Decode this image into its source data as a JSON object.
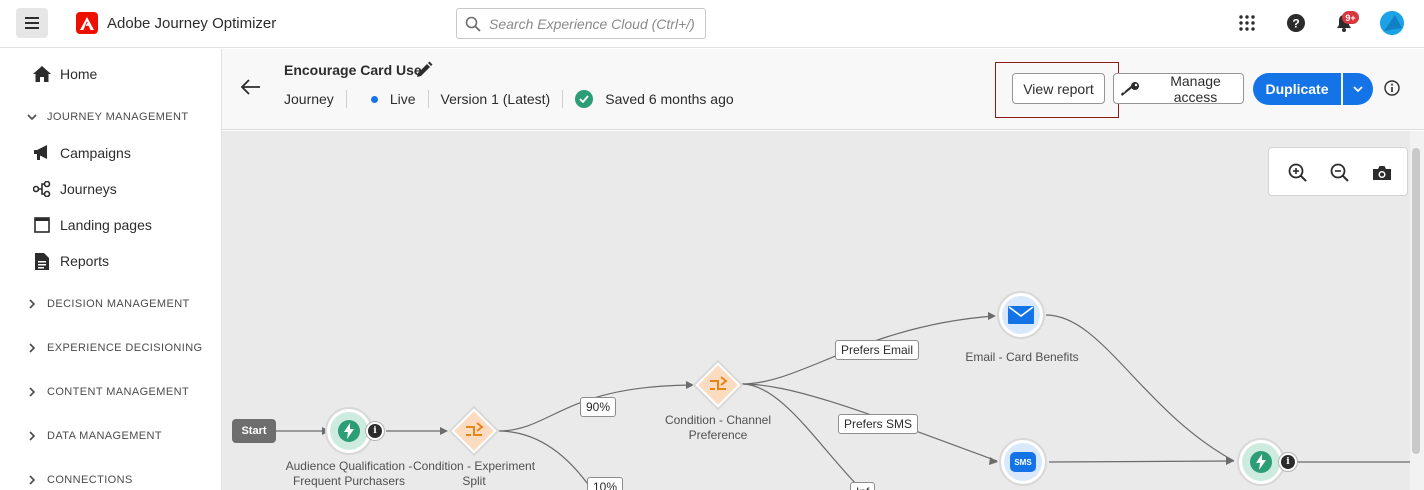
{
  "app": {
    "title": "Adobe Journey Optimizer",
    "search_placeholder": "Search Experience Cloud (Ctrl+/)",
    "notification_badge": "9+",
    "accent": "#1473e6",
    "brand": "#eb1000"
  },
  "sidebar": {
    "home": "Home",
    "journey_management": {
      "label": "JOURNEY MANAGEMENT",
      "items": [
        "Campaigns",
        "Journeys",
        "Landing pages",
        "Reports"
      ]
    },
    "sections": [
      "DECISION MANAGEMENT",
      "EXPERIENCE DECISIONING",
      "CONTENT MANAGEMENT",
      "DATA MANAGEMENT",
      "CONNECTIONS"
    ]
  },
  "header": {
    "journey_name": "Encourage Card Use",
    "type": "Journey",
    "status": "Live",
    "version": "Version 1 (Latest)",
    "saved": "Saved 6 months ago",
    "view_report": "View report",
    "manage_access": "Manage access",
    "duplicate": "Duplicate"
  },
  "canvas": {
    "start": "Start",
    "nodes": {
      "audience": "Audience Qualification - Frequent Purchasers",
      "experiment": "Condition - Experiment Split",
      "channel": "Condition - Channel Preference",
      "email": "Email - Card Benefits",
      "sms_badge": "SMS"
    },
    "edges": {
      "p90": "90%",
      "p10": "10%",
      "prefers_email": "Prefers Email",
      "prefers_sms": "Prefers SMS",
      "partial": "Inf"
    }
  }
}
